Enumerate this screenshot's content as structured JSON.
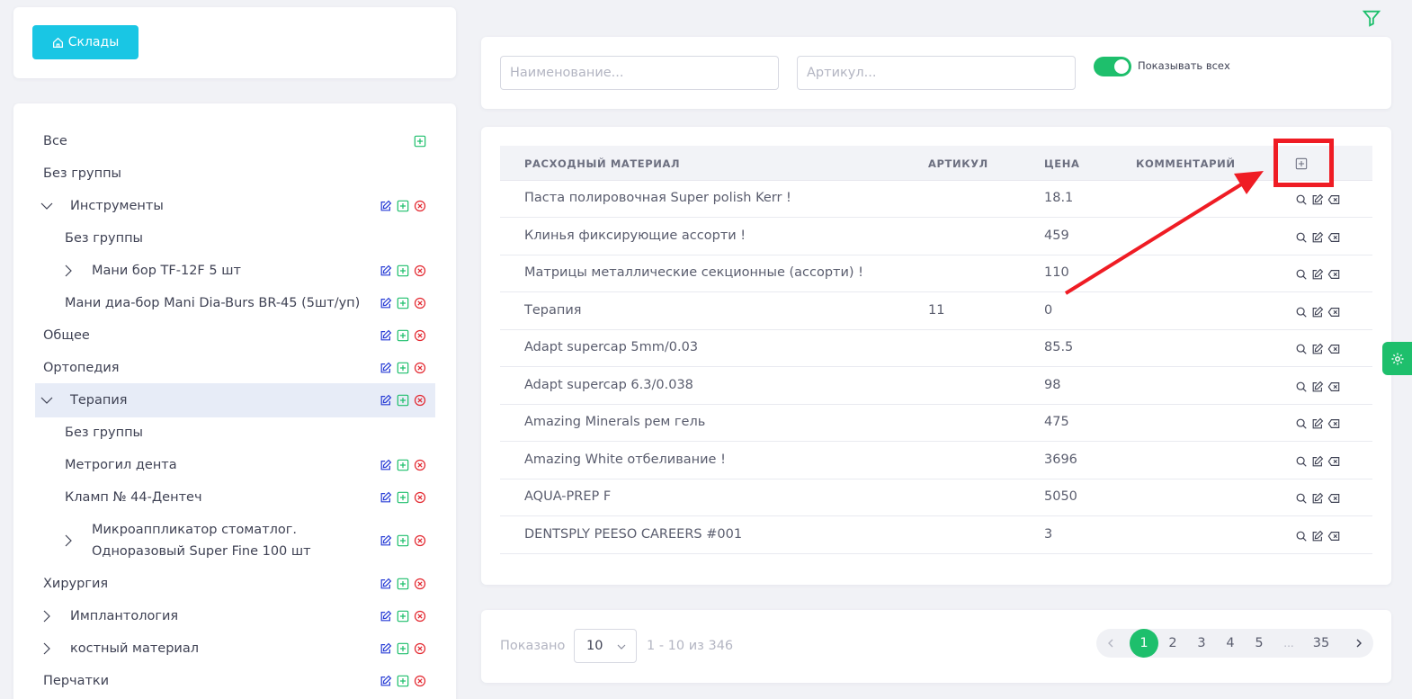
{
  "warehouses_button": {
    "label": "Склады",
    "icon": "home-icon"
  },
  "tree": {
    "items": [
      {
        "label": "Все",
        "level": 0,
        "chevron": "",
        "actions": [
          "add"
        ],
        "selected": false
      },
      {
        "label": "Без группы",
        "level": 0,
        "chevron": "",
        "actions": [],
        "selected": false
      },
      {
        "label": "Инструменты",
        "level": 0,
        "chevron": "down",
        "actions": [
          "edit",
          "add",
          "delete"
        ],
        "selected": false
      },
      {
        "label": "Без группы",
        "level": 1,
        "chevron": "",
        "actions": [],
        "selected": false
      },
      {
        "label": "Мани бор TF-12F 5 шт",
        "level": 1,
        "chevron": "right",
        "actions": [
          "edit",
          "add",
          "delete"
        ],
        "selected": false
      },
      {
        "label": "Мани диа-бор Mani Dia-Burs BR-45 (5шт/уп)",
        "level": 1,
        "chevron": "",
        "actions": [
          "edit",
          "add",
          "delete"
        ],
        "selected": false
      },
      {
        "label": "Общее",
        "level": 0,
        "chevron": "",
        "actions": [
          "edit",
          "add",
          "delete"
        ],
        "selected": false
      },
      {
        "label": "Ортопедия",
        "level": 0,
        "chevron": "",
        "actions": [
          "edit",
          "add",
          "delete"
        ],
        "selected": false
      },
      {
        "label": "Терапия",
        "level": 0,
        "chevron": "down",
        "actions": [
          "edit",
          "add",
          "delete"
        ],
        "selected": true
      },
      {
        "label": "Без группы",
        "level": 1,
        "chevron": "",
        "actions": [],
        "selected": false
      },
      {
        "label": "Метрогил дента",
        "level": 1,
        "chevron": "",
        "actions": [
          "edit",
          "add",
          "delete"
        ],
        "selected": false
      },
      {
        "label": "Кламп № 44-Дентеч",
        "level": 1,
        "chevron": "",
        "actions": [
          "edit",
          "add",
          "delete"
        ],
        "selected": false
      },
      {
        "label": "Микроаппликатор стоматлог.",
        "label2": "Одноразовый Super Fine 100 шт",
        "level": 1,
        "chevron": "right",
        "actions": [
          "edit",
          "add",
          "delete"
        ],
        "selected": false
      },
      {
        "label": "Хирургия",
        "level": 0,
        "chevron": "",
        "actions": [
          "edit",
          "add",
          "delete"
        ],
        "selected": false
      },
      {
        "label": "Имплантология",
        "level": 0,
        "chevron": "right",
        "actions": [
          "edit",
          "add",
          "delete"
        ],
        "selected": false
      },
      {
        "label": "костный материал",
        "level": 0,
        "chevron": "right",
        "actions": [
          "edit",
          "add",
          "delete"
        ],
        "selected": false
      },
      {
        "label": "Перчатки",
        "level": 0,
        "chevron": "",
        "actions": [
          "edit",
          "add",
          "delete"
        ],
        "selected": false
      }
    ]
  },
  "search": {
    "name_placeholder": "Наименование...",
    "article_placeholder": "Артикул...",
    "name_value": "",
    "article_value": "",
    "show_all_label": "Показывать всех",
    "show_all_on": true
  },
  "table": {
    "headers": {
      "material": "РАСХОДНЫЙ МАТЕРИАЛ",
      "article": "АРТИКУЛ",
      "price": "ЦЕНА",
      "comment": "КОММЕНТАРИЙ"
    },
    "rows": [
      {
        "material": "Паста полировочная Super polish Kerr !",
        "article": "",
        "price": "18.1",
        "comment": ""
      },
      {
        "material": "Клинья фиксирующие ассорти !",
        "article": "",
        "price": "459",
        "comment": ""
      },
      {
        "material": "Матрицы металлические секционные (ассорти) !",
        "article": "",
        "price": "110",
        "comment": ""
      },
      {
        "material": "Терапия",
        "article": "11",
        "price": "0",
        "comment": ""
      },
      {
        "material": "Adapt supercap 5mm/0.03",
        "article": "",
        "price": "85.5",
        "comment": ""
      },
      {
        "material": "Adapt supercap 6.3/0.038",
        "article": "",
        "price": "98",
        "comment": ""
      },
      {
        "material": "Amazing Minerals рем гель",
        "article": "",
        "price": "475",
        "comment": ""
      },
      {
        "material": "Amazing White отбеливание !",
        "article": "",
        "price": "3696",
        "comment": ""
      },
      {
        "material": "AQUA-PREP F",
        "article": "",
        "price": "5050",
        "comment": ""
      },
      {
        "material": "DENTSPLY PEESO CAREERS #001",
        "article": "",
        "price": "3",
        "comment": ""
      }
    ]
  },
  "pager": {
    "shown_label": "Показано",
    "page_size": "10",
    "range_label": "1 - 10 из 346",
    "pages": [
      "1",
      "2",
      "3",
      "4",
      "5",
      "...",
      "35"
    ],
    "active_page": "1"
  },
  "colors": {
    "accent_cyan": "#19c6e4",
    "accent_green": "#1ebf6c",
    "edit_blue": "#2a3fd6",
    "delete_red": "#e3262e",
    "annotation_red": "#ef1c24"
  }
}
